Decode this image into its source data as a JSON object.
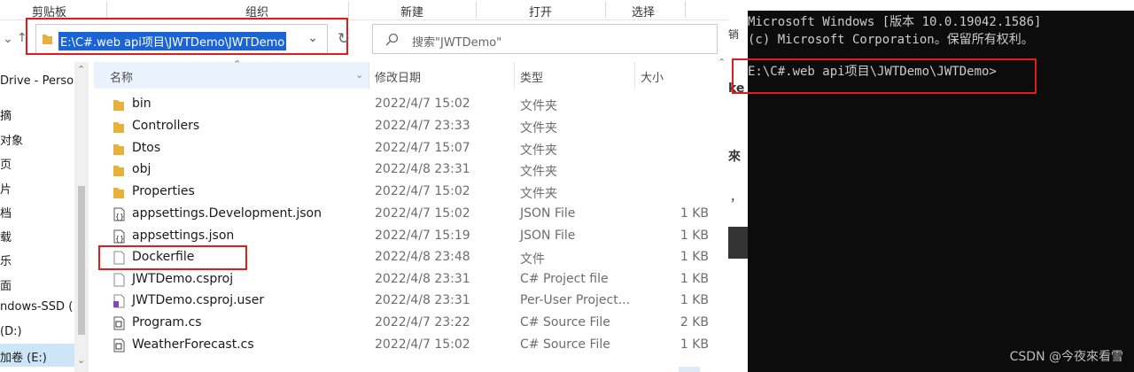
{
  "ribbon": {
    "groups": [
      "剪贴板",
      "组织",
      "新建",
      "打开",
      "选择"
    ]
  },
  "address": {
    "path": "E:\\C#.web api项目\\JWTDemo\\JWTDemo"
  },
  "search": {
    "placeholder": "搜索\"JWTDemo\""
  },
  "nav": {
    "items": [
      "Drive - Perso",
      "摘",
      "对象",
      "页",
      "片",
      "档",
      "载",
      "乐",
      "面",
      "ndows-SSD (",
      "(D:)",
      "加卷 (E:)"
    ]
  },
  "columns": {
    "name": "名称",
    "date": "修改日期",
    "type": "类型",
    "size": "大小"
  },
  "files": [
    {
      "name": "bin",
      "date": "2022/4/7 15:02",
      "type": "文件夹",
      "size": "",
      "icon": "folder-icon"
    },
    {
      "name": "Controllers",
      "date": "2022/4/7 23:33",
      "type": "文件夹",
      "size": "",
      "icon": "folder-icon"
    },
    {
      "name": "Dtos",
      "date": "2022/4/7 15:07",
      "type": "文件夹",
      "size": "",
      "icon": "folder-icon"
    },
    {
      "name": "obj",
      "date": "2022/4/8 23:31",
      "type": "文件夹",
      "size": "",
      "icon": "folder-icon"
    },
    {
      "name": "Properties",
      "date": "2022/4/7 15:02",
      "type": "文件夹",
      "size": "",
      "icon": "folder-icon"
    },
    {
      "name": "appsettings.Development.json",
      "date": "2022/4/7 15:02",
      "type": "JSON File",
      "size": "1 KB",
      "icon": "json-file-icon"
    },
    {
      "name": "appsettings.json",
      "date": "2022/4/7 15:19",
      "type": "JSON File",
      "size": "1 KB",
      "icon": "json-file-icon"
    },
    {
      "name": "Dockerfile",
      "date": "2022/4/8 23:48",
      "type": "文件",
      "size": "1 KB",
      "icon": "file-icon"
    },
    {
      "name": "JWTDemo.csproj",
      "date": "2022/4/8 23:31",
      "type": "C# Project file",
      "size": "1 KB",
      "icon": "file-icon"
    },
    {
      "name": "JWTDemo.csproj.user",
      "date": "2022/4/8 23:31",
      "type": "Per-User Project...",
      "size": "1 KB",
      "icon": "vs-file-icon"
    },
    {
      "name": "Program.cs",
      "date": "2022/4/7 23:22",
      "type": "C# Source File",
      "size": "2 KB",
      "icon": "cs-file-icon"
    },
    {
      "name": "WeatherForecast.cs",
      "date": "2022/4/7 15:02",
      "type": "C# Source File",
      "size": "1 KB",
      "icon": "cs-file-icon"
    }
  ],
  "middle": {
    "fragments": [
      "销",
      "ke",
      "來",
      "，"
    ]
  },
  "console": {
    "lines": [
      "Microsoft Windows [版本 10.0.19042.1586]",
      "(c) Microsoft Corporation。保留所有权利。",
      "",
      "E:\\C#.web api项目\\JWTDemo\\JWTDemo>"
    ]
  },
  "watermark": "CSDN @今夜來看雪",
  "colors": {
    "highlight": "#e31b1b",
    "selection": "#1a64d6",
    "console_bg": "#0c0c0c"
  }
}
